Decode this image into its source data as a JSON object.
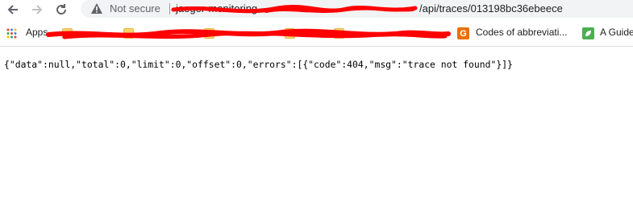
{
  "toolbar": {
    "security_label": "Not secure",
    "url_host": "jaeger-monitoring",
    "url_path": "/api/traces/013198bc36ebeece"
  },
  "bookmarks": {
    "apps_label": "Apps",
    "items": [
      {
        "label": "Codes of abbreviati..."
      },
      {
        "label": "A Guide"
      }
    ]
  },
  "page": {
    "json_text": "{\"data\":null,\"total\":0,\"limit\":0,\"offset\":0,\"errors\":[{\"code\":404,\"msg\":\"trace not found\"}]}"
  },
  "colors": {
    "redaction": "#ff0000",
    "omnibox_bg": "#f1f3f4",
    "folder": "#f7d26b",
    "g_icon": "#e8710a",
    "leaf_icon": "#4caf50"
  }
}
